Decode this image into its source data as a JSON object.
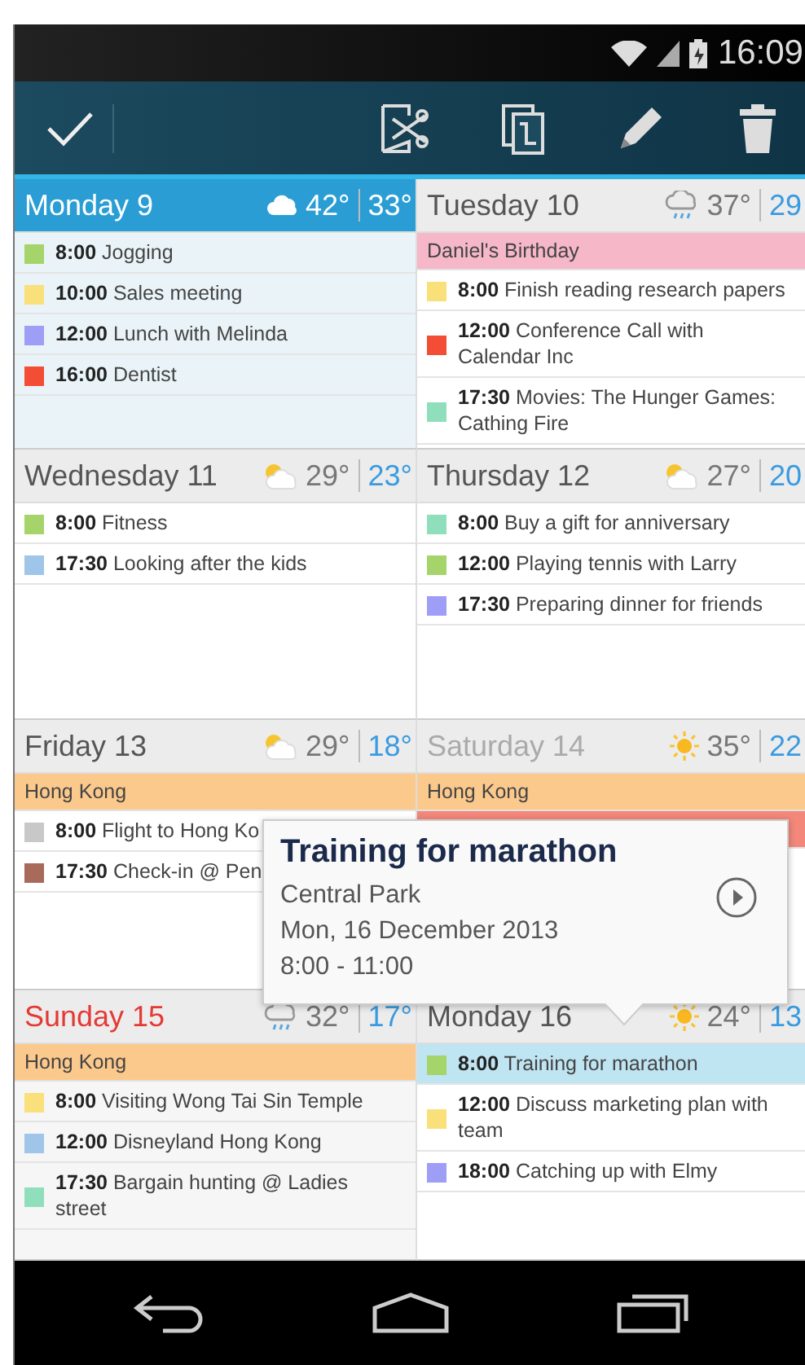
{
  "status_bar": {
    "time": "16:09"
  },
  "days": [
    {
      "name": "Monday 9",
      "kind": "selected",
      "weather": {
        "kind": "cloudy",
        "high": "42°",
        "low": "33°"
      },
      "events": [
        {
          "time": "8:00",
          "title": "Jogging",
          "color": "#a5d46a",
          "selected": false
        },
        {
          "time": "10:00",
          "title": "Sales meeting",
          "color": "#f9e07a",
          "selected": false
        },
        {
          "time": "12:00",
          "title": "Lunch with Melinda",
          "color": "#9e9ef7",
          "selected": false
        },
        {
          "time": "16:00",
          "title": "Dentist",
          "color": "#f44d36",
          "selected": false
        }
      ]
    },
    {
      "name": "Tuesday 10",
      "kind": "normal",
      "weather": {
        "kind": "rain",
        "high": "37°",
        "low": "29"
      },
      "all_day": [
        {
          "title": "Daniel's Birthday",
          "color": "#f6b8c8"
        }
      ],
      "events": [
        {
          "time": "8:00",
          "title": "Finish reading research papers",
          "color": "#f9e07a",
          "selected": false
        },
        {
          "time": "12:00",
          "title": "Conference Call with Calendar Inc",
          "color": "#f44d36",
          "selected": false
        },
        {
          "time": "17:30",
          "title": "Movies: The Hunger Games: Cathing Fire",
          "color": "#8fdfbc",
          "selected": false
        }
      ]
    },
    {
      "name": "Wednesday 11",
      "kind": "normal",
      "weather": {
        "kind": "partly_sunny",
        "high": "29°",
        "low": "23°"
      },
      "events": [
        {
          "time": "8:00",
          "title": "Fitness",
          "color": "#a5d46a",
          "selected": false
        },
        {
          "time": "17:30",
          "title": "Looking after the kids",
          "color": "#9fc5e8",
          "selected": false
        }
      ]
    },
    {
      "name": "Thursday 12",
      "kind": "normal",
      "weather": {
        "kind": "partly_sunny",
        "high": "27°",
        "low": "20"
      },
      "events": [
        {
          "time": "8:00",
          "title": "Buy a gift for anniversary",
          "color": "#8fdfbc",
          "selected": false
        },
        {
          "time": "12:00",
          "title": "Playing tennis with Larry",
          "color": "#a5d46a",
          "selected": false
        },
        {
          "time": "17:30",
          "title": "Preparing dinner for friends",
          "color": "#9e9ef7",
          "selected": false
        }
      ]
    },
    {
      "name": "Friday 13",
      "kind": "normal",
      "weather": {
        "kind": "partly_sunny",
        "high": "29°",
        "low": "18°"
      },
      "all_day": [
        {
          "title": "Hong Kong",
          "color": "#fcc98c"
        }
      ],
      "events": [
        {
          "time": "8:00",
          "title": "Flight to Hong Ko",
          "color": "#c8c8c8",
          "selected": false
        },
        {
          "time": "17:30",
          "title": "Check-in @ Pen",
          "color": "#a86a5a",
          "selected": false
        }
      ]
    },
    {
      "name": "Saturday 14",
      "kind": "dim",
      "weather": {
        "kind": "sunny",
        "high": "35°",
        "low": "22"
      },
      "all_day": [
        {
          "title": "Hong Kong",
          "color": "#fcc98c"
        },
        {
          "color": "#f2877a"
        }
      ]
    },
    {
      "name": "Sunday 15",
      "kind": "sunday",
      "weather": {
        "kind": "rain",
        "high": "32°",
        "low": "17°"
      },
      "all_day": [
        {
          "title": "Hong Kong",
          "color": "#fcc98c"
        }
      ],
      "events": [
        {
          "time": "8:00",
          "title": "Visiting Wong Tai Sin Temple",
          "color": "#f9e07a",
          "selected": false
        },
        {
          "time": "12:00",
          "title": "Disneyland Hong Kong",
          "color": "#9fc5e8",
          "selected": false
        },
        {
          "time": "17:30",
          "title": "Bargain hunting @ Ladies street",
          "color": "#8fdfbc",
          "selected": false
        }
      ]
    },
    {
      "name": "Monday 16",
      "kind": "normal",
      "weather": {
        "kind": "sunny",
        "high": "24°",
        "low": "13"
      },
      "events": [
        {
          "time": "8:00",
          "title": "Training for marathon",
          "color": "#a5d46a",
          "selected": true
        },
        {
          "time": "12:00",
          "title": "Discuss marketing plan with team",
          "color": "#f9e07a",
          "selected": false
        },
        {
          "time": "18:00",
          "title": "Catching up with Elmy",
          "color": "#9e9ef7",
          "selected": false
        }
      ]
    }
  ],
  "popup": {
    "title": "Training for marathon",
    "location": "Central Park",
    "date": "Mon, 16 December 2013",
    "time": "8:00 - 11:00"
  }
}
